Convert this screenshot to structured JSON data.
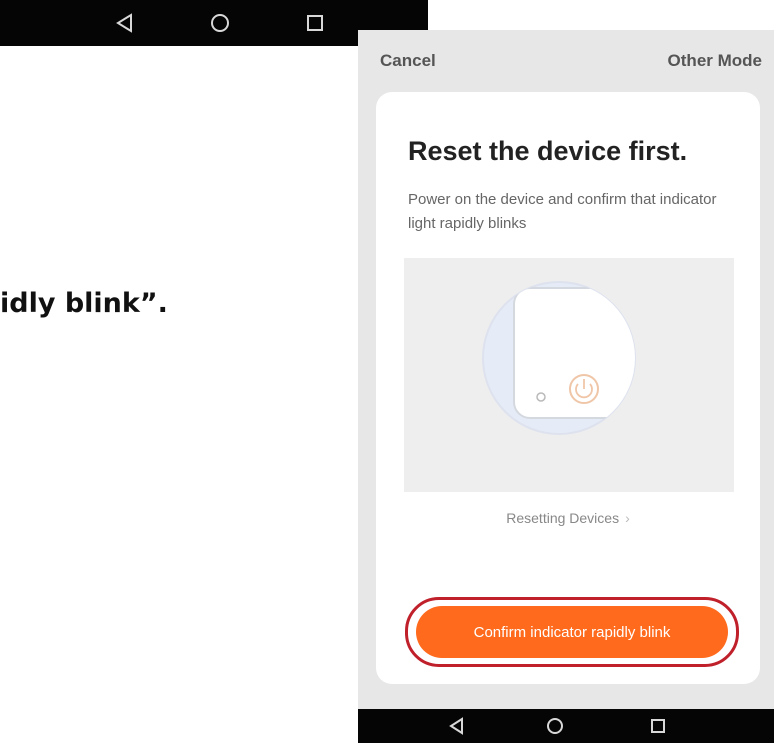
{
  "left_caption": "idly blink”.",
  "phone": {
    "header": {
      "cancel_label": "Cancel",
      "other_mode_label": "Other Mode"
    },
    "card": {
      "title": "Reset the device first.",
      "description": "Power on the device and confirm that indicator light rapidly blinks",
      "reset_link_label": "Resetting Devices",
      "confirm_button_label": "Confirm indicator rapidly blink"
    }
  },
  "nav_icons": [
    "back-triangle-icon",
    "home-circle-icon",
    "recents-square-icon"
  ],
  "colors": {
    "accent": "#ff6a1c",
    "highlight_ring": "#c0202a",
    "nav_bar": "#050505",
    "screen_bg": "#e7e7e7"
  }
}
